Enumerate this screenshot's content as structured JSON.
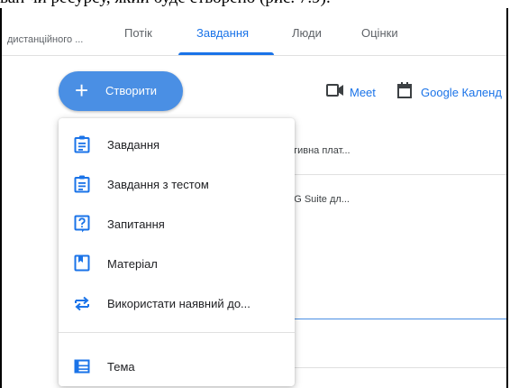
{
  "caption": "ван чи ресурсу, який буде створено (рис. 7.9).",
  "breadcrumb": "дистанційного ...",
  "tabs": [
    {
      "label": "Потік"
    },
    {
      "label": "Завдання"
    },
    {
      "label": "Люди"
    },
    {
      "label": "Оцінки"
    }
  ],
  "active_tab": "Завдання",
  "create_button": {
    "label": "Створити",
    "icon": "plus-icon"
  },
  "toolbar": {
    "meet_label": "Meet",
    "calendar_label": "Google Календ"
  },
  "background_items": [
    {
      "text": "ективна плат..."
    },
    {
      "text": "/ «G Suite дл..."
    }
  ],
  "menu": {
    "items": [
      {
        "label": "Завдання",
        "icon": "assignment-icon"
      },
      {
        "label": "Завдання з тестом",
        "icon": "quiz-assignment-icon"
      },
      {
        "label": "Запитання",
        "icon": "question-icon"
      },
      {
        "label": "Матеріал",
        "icon": "material-icon"
      },
      {
        "label": "Використати наявний до...",
        "icon": "reuse-post-icon"
      },
      {
        "label": "Тема",
        "icon": "topic-icon"
      }
    ]
  },
  "colors": {
    "accent": "#1a73e8",
    "button": "#4a8fe4",
    "icon": "#1a73e8"
  }
}
